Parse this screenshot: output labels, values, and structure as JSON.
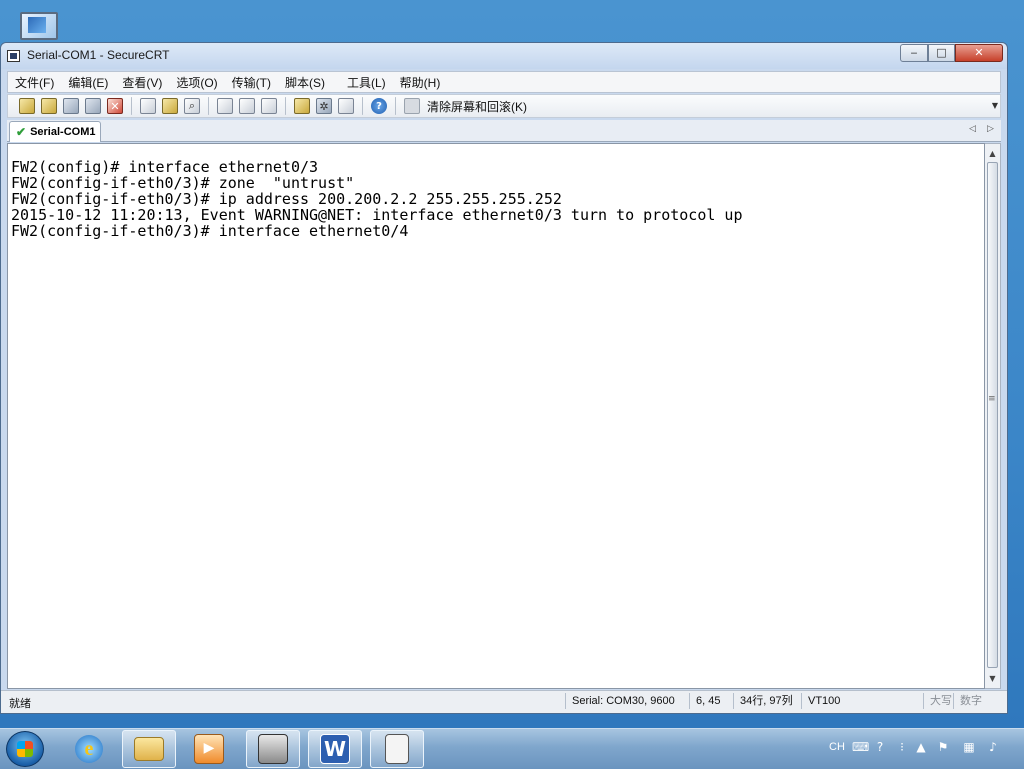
{
  "window": {
    "title": "Serial-COM1 - SecureCRT",
    "min_label": "‒",
    "max_label": "□",
    "close_label": "✕"
  },
  "menu": [
    "文件(F)",
    "编辑(E)",
    "查看(V)",
    "选项(O)",
    "传输(T)",
    "脚本(S)",
    "工具(L)",
    "帮助(H)"
  ],
  "toolbar": {
    "clear_label": "清除屏幕和回滚(K)"
  },
  "tabs": [
    {
      "label": "Serial-COM1",
      "active": true
    }
  ],
  "terminal": {
    "lines": [
      "FW2(config)# interface ethernet0/3",
      "FW2(config-if-eth0/3)# zone  \"untrust\"",
      "FW2(config-if-eth0/3)# ip address 200.200.2.2 255.255.255.252",
      "2015-10-12 11:20:13, Event WARNING@NET: interface ethernet0/3 turn to protocol up",
      "FW2(config-if-eth0/3)# interface ethernet0/4"
    ]
  },
  "status": {
    "ready": "就绪",
    "connection": "Serial: COM30, 9600",
    "cursor": "6, 45",
    "size": "34行, 97列",
    "emulation": "VT100",
    "caps": "大写",
    "num": "数字"
  },
  "tray": {
    "lang": "CH"
  },
  "taskbar_items": [
    "internet-explorer",
    "file-explorer",
    "media-player",
    "securecrt",
    "wps-writer",
    "document-viewer"
  ]
}
